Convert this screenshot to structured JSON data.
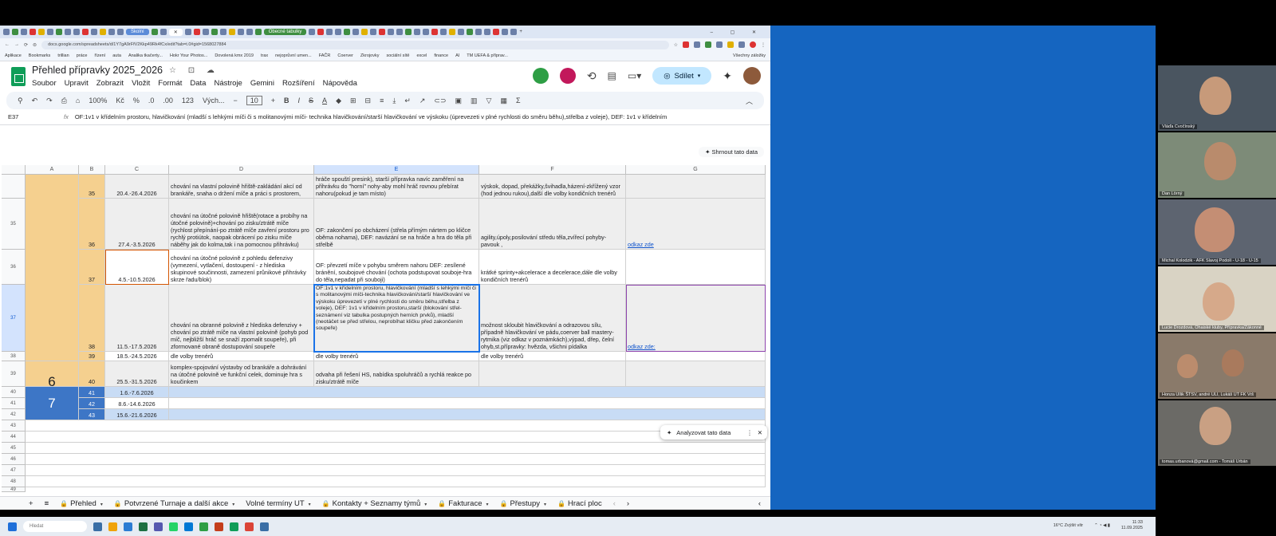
{
  "browser": {
    "active_tab": "Přehled",
    "group_chip_1": "Školní",
    "group_chip_2": "Obecné tabulky",
    "url": "docs.google.com/spreadsheets/d/1Y7gA9rFfV2Kkp49Rk4fCx/edit?tab=t.0#gid=1568027884",
    "bookmarks": [
      "Aplikace",
      "Bookmarks",
      "trillian",
      "práce",
      "řízení",
      "auta",
      "Analika tkačerty...",
      "Hokr Your Photos...",
      "Dovolená kmx 2019",
      "trax",
      "nejoprůvní umen...",
      "FAČR",
      "Coerver",
      "Zkrojovky",
      "sociální sítě",
      "excel",
      "finance",
      "AI",
      "TM UEFA & příprav..."
    ],
    "bookmarks_right": "Všechny záložky"
  },
  "doc": {
    "title": "Přehled  přípravky 2025_2026",
    "title_icons": "☆ ⊡ ☁",
    "menu": [
      "Soubor",
      "Upravit",
      "Zobrazit",
      "Vložit",
      "Formát",
      "Data",
      "Nástroje",
      "Gemini",
      "Rozšíření",
      "Nápověda"
    ],
    "share_label": "Sdílet"
  },
  "toolbar": {
    "zoom": "100%",
    "currency": "Kč",
    "percent": "%",
    "dec_less": ".0",
    "dec_more": ".00",
    "num_format": "123",
    "font": "Vých...",
    "font_size": "10",
    "minus": "−",
    "plus": "+"
  },
  "formula_bar": {
    "cell_ref": "E37",
    "fx": "fx",
    "content": "OF:1v1 v křídelním prostoru, hlavičkování (mladší s lehkými míči či s molitanovými míči- technika hlavičkování/starší hlavičkování ve výskoku (úprevezeti v plné rychlosti do směru běhu),střelba z voleje), DEF: 1v1 v křídelním",
    "summarize": "Shrnout tato data"
  },
  "grid": {
    "columns": [
      "A",
      "B",
      "C",
      "D",
      "E",
      "F",
      "G"
    ],
    "row_numbers": [
      "",
      "35",
      "36",
      "37",
      "38",
      "39",
      "40",
      "41",
      "42",
      "43",
      "44",
      "45",
      "46",
      "47",
      "48",
      "49"
    ],
    "rows": [
      {
        "b": "35",
        "c": "20.4.-26.4.2026",
        "d": "chování na vlastní polovině hřiště-zakládání akcí od brankáře, snaha o držení míče a práci s prostorem,",
        "e": "hráče spouští presink), starší přípravka navíc zaměření na přihrávku do \"horní\" nohy-aby mohl hráč rovnou přebírat nahoru(pokud je tam místo)",
        "f": "výskok, dopad, překážky,švihadla,házení-zkřížený vzor (hod jednou rukou),další dle volby kondičních trenérů",
        "g": ""
      },
      {
        "b": "36",
        "c": "27.4.-3.5.2026",
        "d": "chování na útočné polovině hřiště(rotace a probíhy na útočné polovině)+chování po zisku/ztrátě míče (rychlost přepínání-po ztrátě míče zavření prostoru pro rychlý protiútok, naopak obrácení po zisku míče náběhy jak do kolma,tak i na pomocnou přihrávku)",
        "e": "OF: zakončení po obcházení (střela přímým nártem po kličce oběma nohama), DEF: navázání se na hráče a hra do těla při střelbě",
        "f": "agility,úpoly,posilování středu těla,zvířecí pohyby-pavouk ,",
        "g": "odkaz zde"
      },
      {
        "b": "37",
        "c": "4.5.-10.5.2026",
        "d": "chování na útočné polovině z pohledu defenzivy (vymezení, vytlačení, dostoupení - z hlediska skupinové součinnosti, zamezení průnikové přihrávky skrze řadu/blok)",
        "e": "OF:  převzetí míče v pohybu směrem nahoru DEF: zesílené bránění, soubojové chování (ochota podstupovat souboje-hra do těla,nepadat při souboji)",
        "f": "krátké sprinty+akcelerace a decelerace,dále dle volby kondičních trenérů",
        "g": ""
      },
      {
        "b": "38",
        "c": "11.5.-17.5.2026",
        "d": "chování na obranné polovině z hlediska defenzivy + chování po ztrátě míče na vlastní polovině (pohyb pod míč, nejbližší hráč se snaží zpomalit soupeře), při zformované obraně dostupování soupeře",
        "e": "OF:1v1 v křídelním prostoru, hlavičkování (mladší s lehkými míči či s molitanovými míči-technika hlavičkování/starší hlavičkování ve výskoku úprevezetí v plné rychlosti do směru běhu,střelba z voleje), DEF: 1v1 v křídelním prostoru,starší (blokování střel-seznámení viz tabulka postupných herních prvků), mladší (neotáčet se před střelou, neprobíhat kličku před zakončením soupeře)",
        "f": "možnost skloubit hlavičkování a odrazovou sílu, případně hlavičkování ve pádu,coerver ball mastery-rytmika (viz odkaz v poznámkách),výpad, dřep, čelní ohyb,st.přípravky: hvězda, všichni pídalka",
        "g": "odkaz zde:"
      },
      {
        "b": "39",
        "c": "18.5.-24.5.2026",
        "d": "dle volby trenérů",
        "e": "dle volby trenérů",
        "f": "dle volby trenérů",
        "g": ""
      },
      {
        "b": "40",
        "c": "25.5.-31.5.2026",
        "d": "komplex-spojování výstavby od brankáře a dohrávání na útočné polovině ve funkční celek, dominuje hra s koučinkem",
        "e": "odvaha při řešení HS, nabídka spoluhráčů a rychlá reakce po zisku/ztrátě míče",
        "f": "",
        "g": ""
      },
      {
        "b": "41",
        "c": "1.6.-7.6.2026",
        "d": "",
        "e": "",
        "f": "",
        "g": ""
      },
      {
        "b": "42",
        "c": "8.6.-14.6.2026",
        "d": "",
        "e": "",
        "f": "",
        "g": ""
      },
      {
        "b": "43",
        "c": "15.6.-21.6.2026",
        "d": "",
        "e": "",
        "f": "",
        "g": ""
      }
    ],
    "month_6": "6",
    "month_7": "7"
  },
  "analyze_label": "Analyzovat tato data",
  "sheet_tabs": [
    {
      "label": "Přehled",
      "locked": true
    },
    {
      "label": "Potvrzené Turnaje a další akce",
      "locked": true
    },
    {
      "label": "Volné termíny UT",
      "locked": false
    },
    {
      "label": "Kontakty + Seznamy týmů",
      "locked": true
    },
    {
      "label": "Fakturace",
      "locked": true
    },
    {
      "label": "Přestupy",
      "locked": true
    },
    {
      "label": "Hrací ploc",
      "locked": true
    }
  ],
  "taskbar": {
    "search": "Hledat",
    "weather": "16°C Zvýšit vítr",
    "time": "11:33",
    "date": "11.09.2025"
  },
  "participants": [
    {
      "name": "Vláďa Cvočínský"
    },
    {
      "name": "Dan Lörný"
    },
    {
      "name": "Michal Kolodzik - AFK Slavoj Podolí - U-18 - U-15"
    },
    {
      "name": "Lucie Drozdová, Ohaiské kluby, Přípravka/Zákonné"
    },
    {
      "name": "Honza Ullik ŠTSV, andré ULI, Lukáš UT FK Vrš"
    },
    {
      "name": "tomas.urbanová@gmail.com - Tomáš Urbán"
    }
  ]
}
